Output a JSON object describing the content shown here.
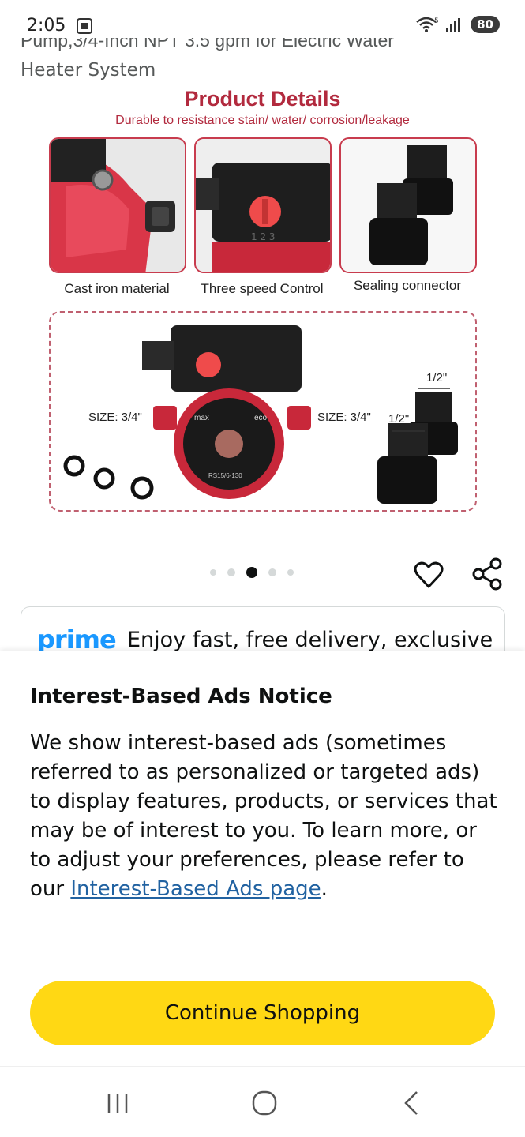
{
  "status_bar": {
    "time": "2:05",
    "battery": "80",
    "wifi_badge": "5"
  },
  "product": {
    "title_line_cut": "Pump,3/4-Inch NPT 3.5 gpm for Electric Water",
    "title_line2": "Heater System"
  },
  "image": {
    "heading": "Product Details",
    "subheading": "Durable to resistance stain/ water/ corrosion/leakage",
    "thumbs": [
      {
        "caption": "Cast iron material"
      },
      {
        "caption": "Three speed Control"
      },
      {
        "caption": "Sealing connector"
      }
    ],
    "size_left": "SIZE: 3/4\"",
    "size_right": "SIZE: 3/4\"",
    "half_inch_top": "1/2\"",
    "half_inch_side": "1/2\"",
    "plate_max": "max",
    "plate_eco": "eco",
    "plate_model": "RS15/6-130"
  },
  "carousel": {
    "dot_count": 5,
    "active_index": 2
  },
  "prime": {
    "logo": "prime",
    "text": "Enjoy fast, free delivery, exclusive"
  },
  "notice": {
    "title": "Interest-Based Ads Notice",
    "body_before_link": "We show interest-based ads (sometimes referred to as personalized or targeted ads) to display features, products, or services that may be of interest to you. To learn more, or to adjust your preferences, please refer to our ",
    "link_text": "Interest-Based Ads page",
    "body_after_link": ".",
    "button_label": "Continue Shopping",
    "button_color": "#ffd814"
  },
  "navbar": {
    "recent_icon": "recent-apps-icon",
    "home_icon": "home-icon",
    "back_icon": "back-icon"
  }
}
